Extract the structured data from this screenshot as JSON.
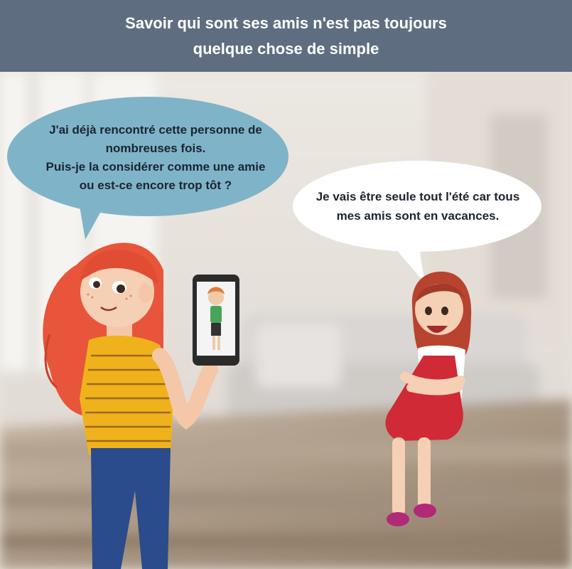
{
  "header": {
    "title_line1": "Savoir qui sont ses amis n'est pas toujours",
    "title_line2": "quelque chose de simple"
  },
  "bubbles": {
    "left": {
      "lines": [
        "J'ai déjà rencontré cette personne de",
        "nombreuses fois.",
        "Puis-je la considérer comme une amie",
        "ou est-ce encore trop tôt ?"
      ]
    },
    "right": {
      "lines": [
        "Je vais être seule tout l'été car tous",
        "mes amis sont en vacances."
      ]
    }
  },
  "colors": {
    "header_bg": "#5e6e80",
    "left_bubble": "#7fb3c8",
    "right_bubble": "#ffffff",
    "text": "#1b2530"
  }
}
